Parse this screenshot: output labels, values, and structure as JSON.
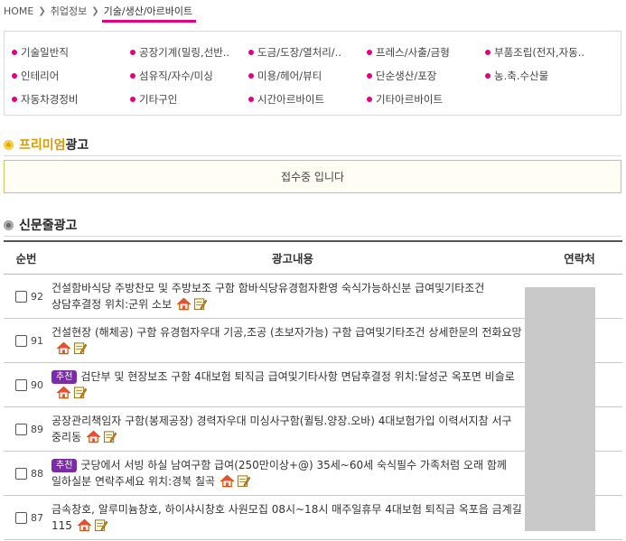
{
  "breadcrumb": {
    "home": "HOME",
    "level1": "취업정보",
    "current": "기술/생산/아르바이트"
  },
  "categories": [
    "기술일반직",
    "공장기계(밀링,선반..",
    "도금/도장/열처리/..",
    "프레스/사출/금형",
    "부품조립(전자,자동..",
    "인테리어",
    "섬유직/자수/미싱",
    "미용/헤어/뷰티",
    "단순생산/포장",
    "농.축.수산물",
    "자동차경정비",
    "기타구인",
    "시간아르바이트",
    "기타아르바이트"
  ],
  "premium": {
    "title_em": "프리미엄",
    "title_rest": "광고",
    "message": "접수중 입니다"
  },
  "newspaper": {
    "title": "신문줄광고",
    "headers": {
      "no": "순번",
      "content": "광고내용",
      "contact": "연락처"
    },
    "rows": [
      {
        "no": "92",
        "badge": "",
        "text": "건설함바식당 주방찬모 및 주방보조 구함 함바식당유경험자환영 숙식가능하신분 급여및기타조건 상담후결정 위치:군위 소보"
      },
      {
        "no": "91",
        "badge": "",
        "text": "건설현장 (해체공) 구함 유경험자우대 기공,조공 (초보자가능) 구함 급여및기타조건 상세한문의 전화요망"
      },
      {
        "no": "90",
        "badge": "추천",
        "text": "검단부 및 현장보조 구함 4대보험 퇴직금 급여및기타사항 면담후결정 위치:달성군 옥포면 비슬로"
      },
      {
        "no": "89",
        "badge": "",
        "text": "공장관리책임자 구함(봉제공장) 경력자우대 미싱사구함(퀼팅.양장.오바) 4대보험가입 이력서지참 서구 중리동"
      },
      {
        "no": "88",
        "badge": "추천",
        "text": "굿당에서 서빙 하실 남여구함 급여(250만이상+@) 35세~60세 숙식필수 가족처럼 오래 함께 일하실분 연락주세요 위치:경북 칠곡"
      },
      {
        "no": "87",
        "badge": "",
        "text": "금속창호, 알루미늄창호, 하이샤시창호 사원모집 08시~18시 매주일휴무 4대보험 퇴직금 옥포읍 금계길 115"
      }
    ]
  },
  "colors": {
    "accent": "#e4007f",
    "premium": "#d99a00",
    "badge": "#7b2aa8"
  }
}
